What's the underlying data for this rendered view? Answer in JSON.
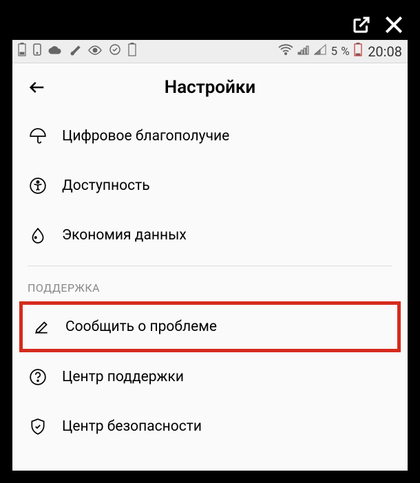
{
  "statusBar": {
    "batteryPercent": "5 %",
    "time": "20:08"
  },
  "header": {
    "title": "Настройки"
  },
  "items": [
    {
      "label": "Цифровое благополучие",
      "icon": "umbrella"
    },
    {
      "label": "Доступность",
      "icon": "accessibility"
    },
    {
      "label": "Экономия данных",
      "icon": "drop"
    }
  ],
  "section": {
    "header": "ПОДДЕРЖКА"
  },
  "supportItems": [
    {
      "label": "Сообщить о проблеме",
      "icon": "edit",
      "highlighted": true
    },
    {
      "label": "Центр поддержки",
      "icon": "help"
    },
    {
      "label": "Центр безопасности",
      "icon": "shield"
    }
  ]
}
